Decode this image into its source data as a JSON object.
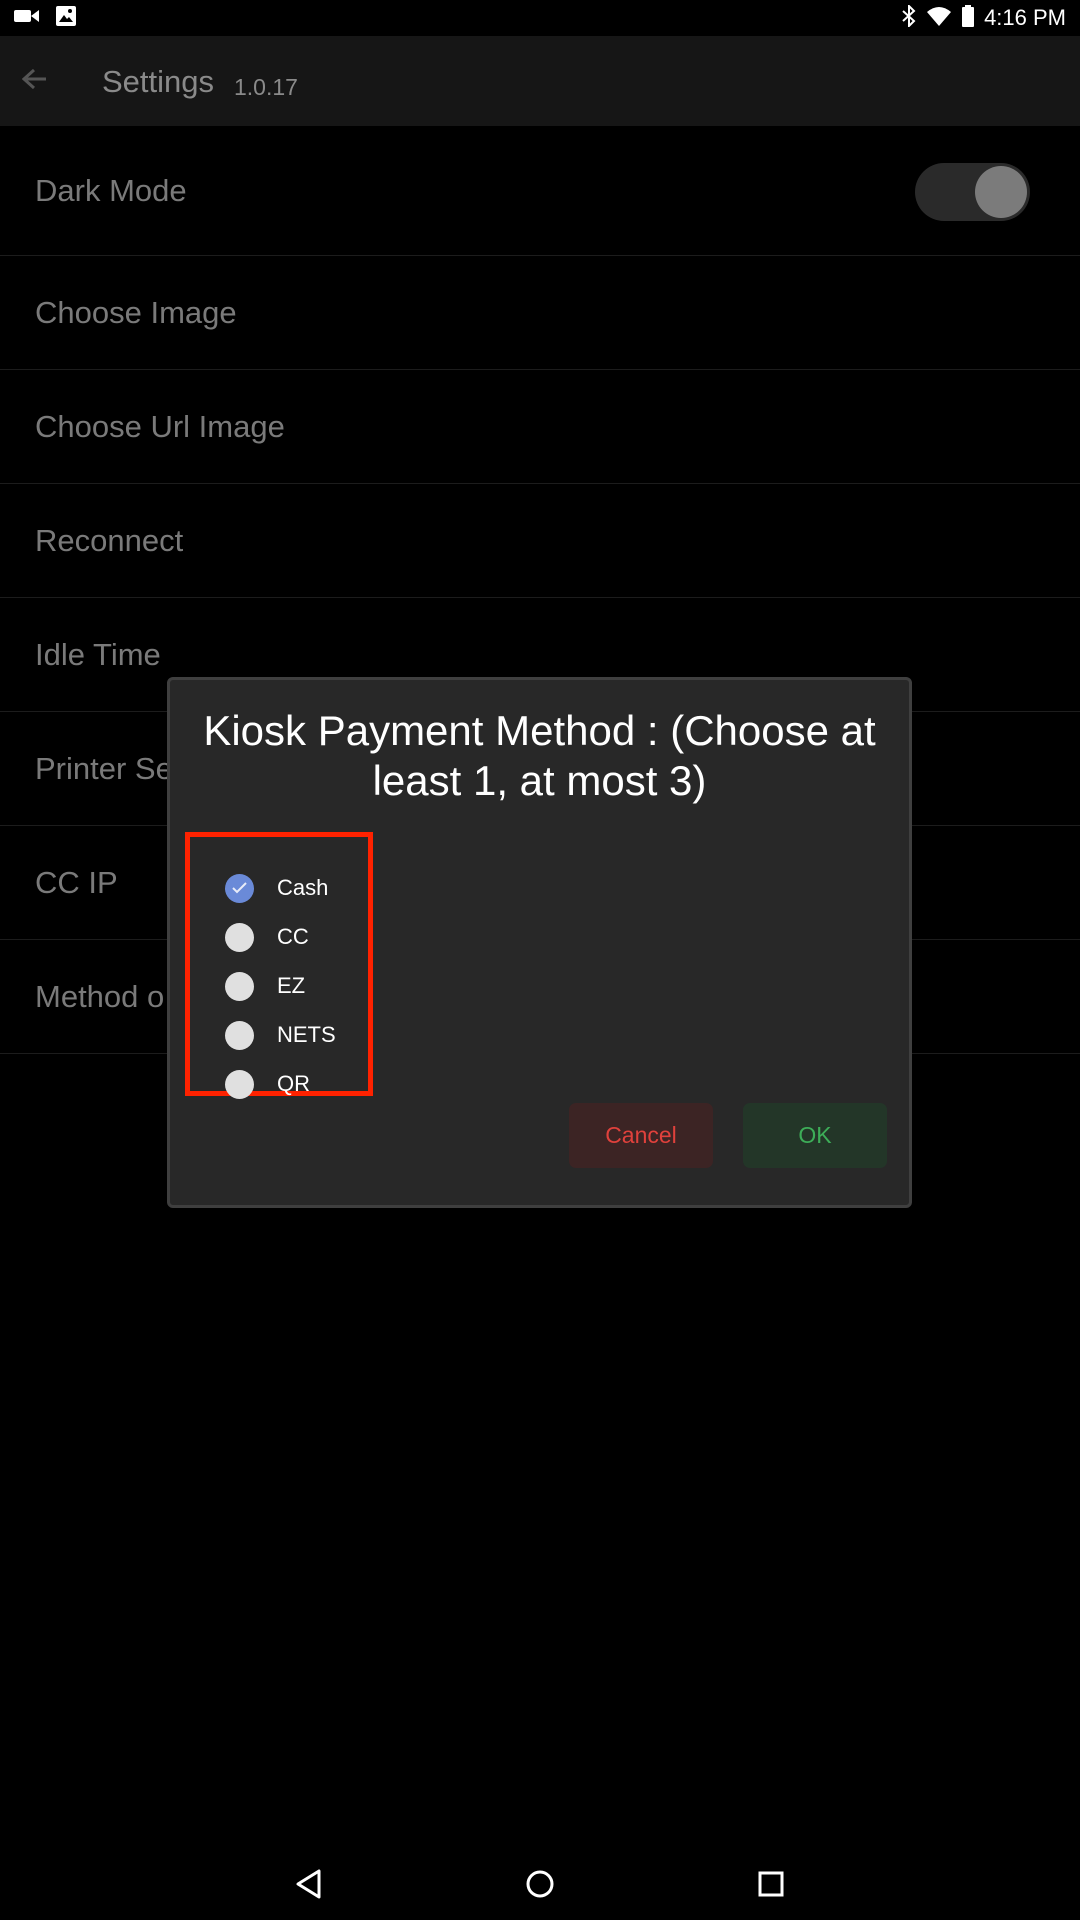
{
  "status_bar": {
    "time": "4:16 PM",
    "left_icons": [
      "video-camera-icon",
      "image-icon"
    ],
    "right_icons": [
      "bluetooth-icon",
      "wifi-icon",
      "battery-icon"
    ]
  },
  "app_bar": {
    "title": "Settings",
    "version": "1.0.17"
  },
  "settings": {
    "items": [
      {
        "label": "Dark Mode",
        "toggle": true
      },
      {
        "label": "Choose Image"
      },
      {
        "label": "Choose Url Image"
      },
      {
        "label": "Reconnect"
      },
      {
        "label": "Idle Time"
      },
      {
        "label": "Printer Se"
      },
      {
        "label": "CC IP"
      },
      {
        "label": "Method o"
      }
    ]
  },
  "dialog": {
    "title": "Kiosk Payment Method : (Choose at least 1, at most 3)",
    "options": [
      {
        "label": "Cash",
        "checked": true
      },
      {
        "label": "CC",
        "checked": false
      },
      {
        "label": "EZ",
        "checked": false
      },
      {
        "label": "NETS",
        "checked": false
      },
      {
        "label": "QR",
        "checked": false
      }
    ],
    "cancel_label": "Cancel",
    "ok_label": "OK"
  },
  "colors": {
    "highlight": "#ff2200",
    "cancel_text": "#e0413c",
    "ok_text": "#3dad58",
    "radio_checked": "#6a8ad8"
  },
  "nav_bar": {
    "icons": [
      "back-triangle-icon",
      "home-circle-icon",
      "recents-square-icon"
    ]
  }
}
